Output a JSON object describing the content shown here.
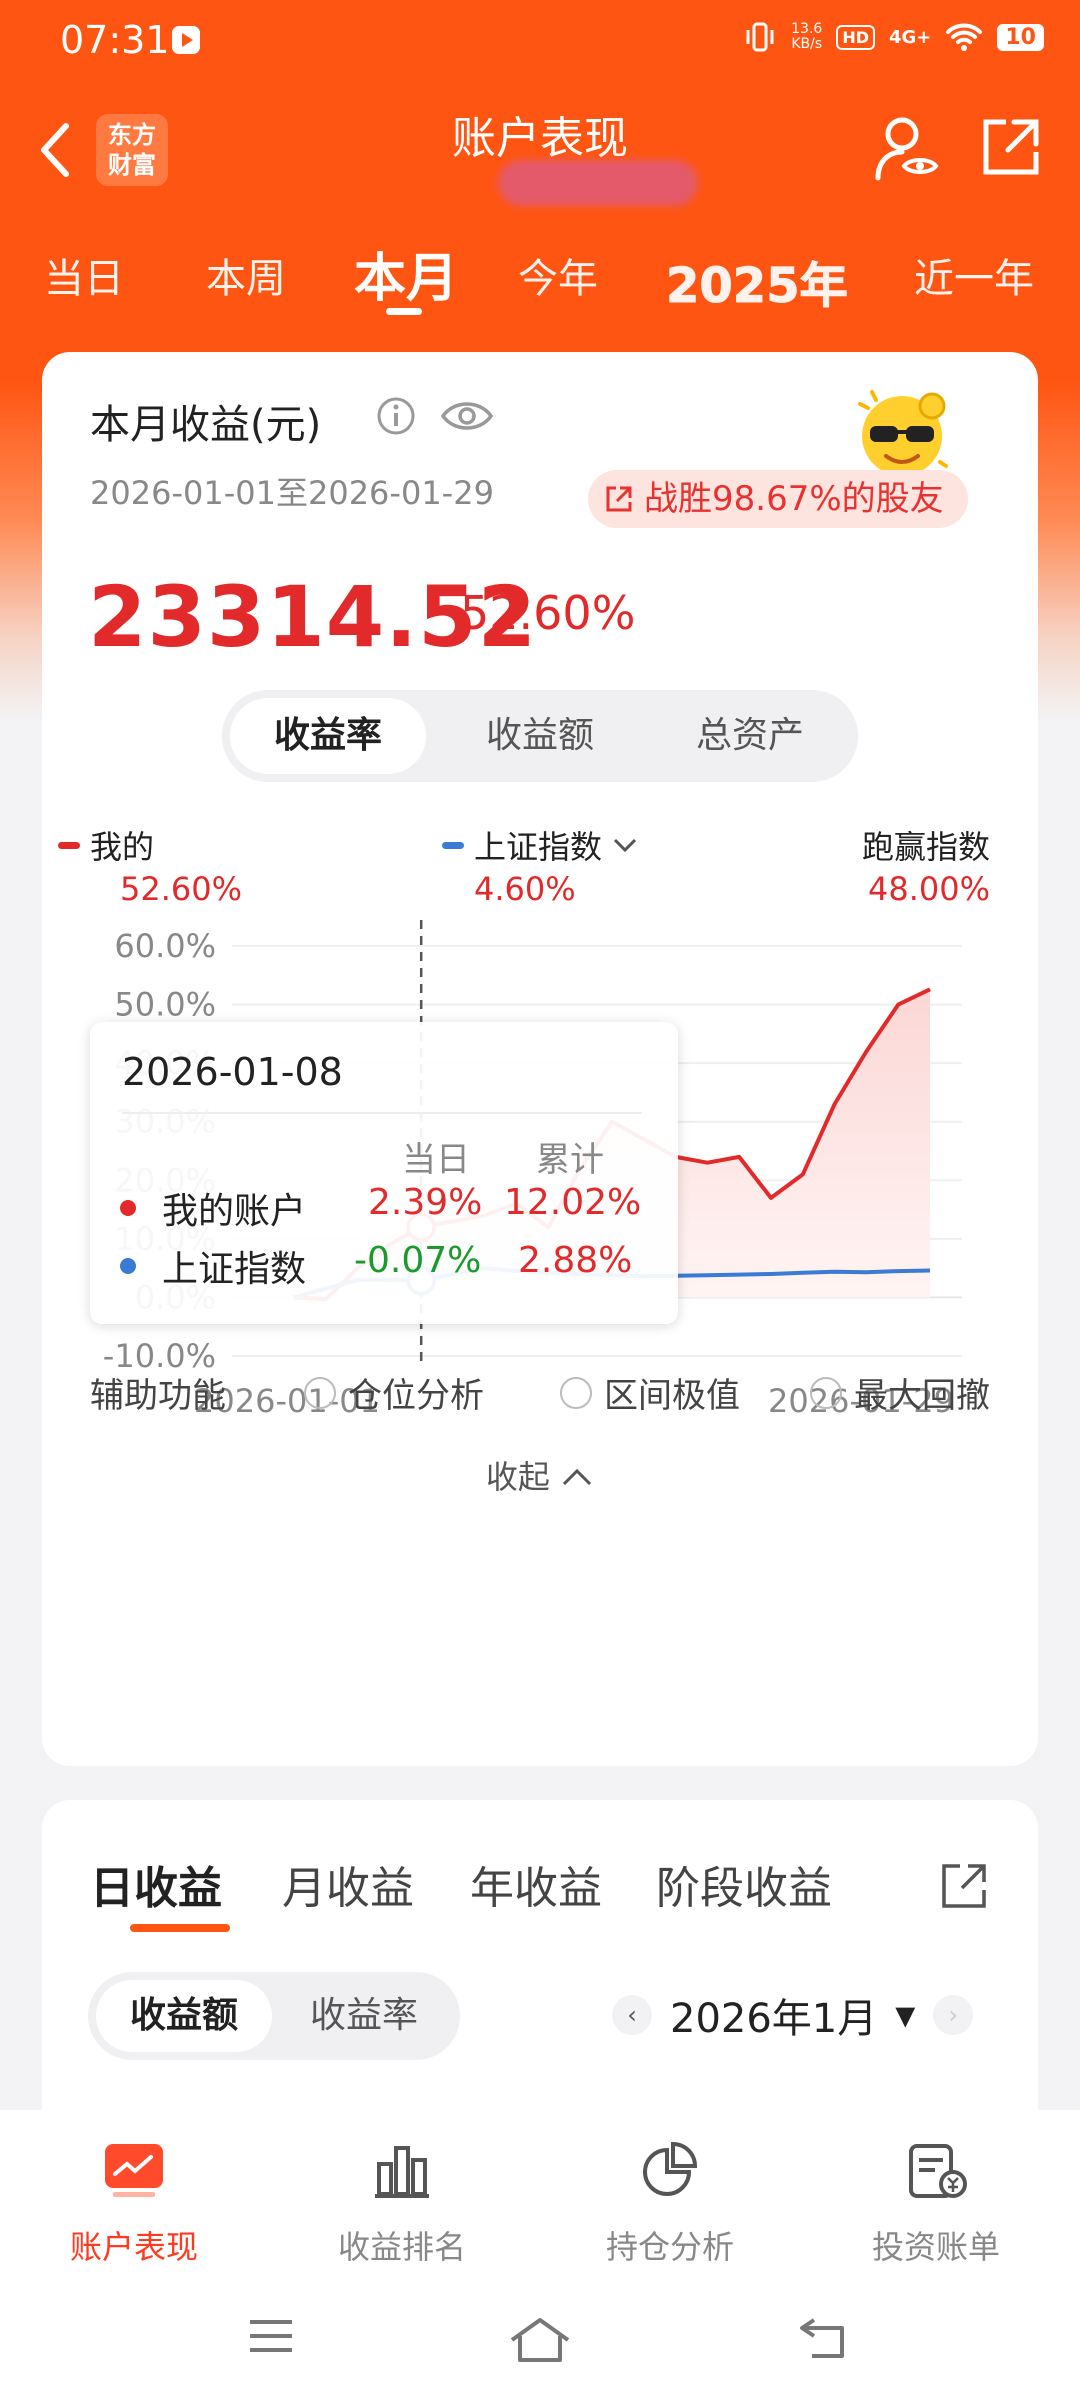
{
  "status_bar": {
    "time": "07:31",
    "net_speed_top": "13.6",
    "net_speed_unit": "KB/s",
    "hd": "HD",
    "network": "4G+",
    "battery": "10"
  },
  "header": {
    "title": "账户表现",
    "logo_text_1": "东方",
    "logo_text_2": "财富"
  },
  "period_tabs": [
    "当日",
    "本周",
    "本月",
    "今年",
    "2025年",
    "近一年"
  ],
  "active_period": "本月",
  "summary": {
    "title": "本月收益(元)",
    "date_range": "2026-01-01至2026-01-29",
    "beat_text": "战胜98.67%的股友",
    "amount": "23314.52",
    "percent": "52.60%"
  },
  "metric_toggle": [
    "收益率",
    "收益额",
    "总资产"
  ],
  "legend": {
    "mine_label": "我的",
    "mine_value": "52.60%",
    "index_label": "上证指数",
    "index_value": "4.60%",
    "excess_label": "跑赢指数",
    "excess_value": "48.00%"
  },
  "chart_data": {
    "type": "line",
    "ylim": [
      -10,
      60
    ],
    "yticks": [
      "60.0%",
      "50.0%",
      "40.0%",
      "30.0%",
      "20.0%",
      "10.0%",
      "0.0%",
      "-10.0%"
    ],
    "x_start_label": "2026-01-01",
    "x_end_label": "2026-01-29",
    "series": [
      {
        "name": "我的",
        "color": "#e32a2a",
        "values": [
          0,
          -0.3,
          5,
          9,
          12.02,
          13,
          14,
          16,
          12,
          22,
          30,
          27,
          24,
          23,
          24,
          17,
          21,
          33,
          42,
          50,
          52.6
        ]
      },
      {
        "name": "上证指数",
        "color": "#3a7bd5",
        "values": [
          0,
          1.5,
          3,
          3,
          2.88,
          4,
          5,
          4.5,
          4.2,
          4,
          3.8,
          3.6,
          3.7,
          3.8,
          3.9,
          4,
          4.2,
          4.4,
          4.3,
          4.5,
          4.6
        ]
      }
    ],
    "highlight_index": 4
  },
  "tooltip": {
    "date": "2026-01-08",
    "col_day": "当日",
    "col_total": "累计",
    "row1_name": "我的账户",
    "row1_day": "2.39%",
    "row1_total": "12.02%",
    "row2_name": "上证指数",
    "row2_day": "-0.07%",
    "row2_total": "2.88%"
  },
  "aux": {
    "label": "辅助功能",
    "options": [
      "仓位分析",
      "区间极值",
      "最大回撤"
    ]
  },
  "collapse_label": "收起",
  "profit_tabs": [
    "日收益",
    "月收益",
    "年收益",
    "阶段收益"
  ],
  "profit_toggle": [
    "收益额",
    "收益率"
  ],
  "month_label": "2026年1月",
  "bottom_nav": [
    "账户表现",
    "收益排名",
    "持仓分析",
    "投资账单"
  ],
  "colors": {
    "brand": "#ff5512",
    "up": "#e32a2a",
    "down": "#1a9a2a",
    "index": "#3a7bd5"
  }
}
